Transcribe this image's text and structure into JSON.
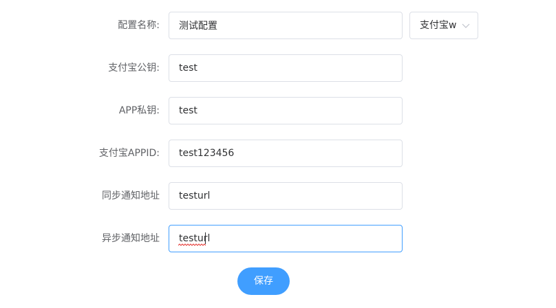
{
  "form": {
    "config_name": {
      "label": "配置名称:",
      "value": "测试配置",
      "select_value": "支付宝w"
    },
    "alipay_public_key": {
      "label": "支付宝公钥:",
      "value": "test"
    },
    "app_private_key": {
      "label": "APP私钥:",
      "value": "test"
    },
    "alipay_appid": {
      "label": "支付宝APPID:",
      "value": "test123456"
    },
    "sync_notify_url": {
      "label": "同步通知地址",
      "value": "testurl"
    },
    "async_notify_url": {
      "label": "异步通知地址",
      "value": "testurl"
    }
  },
  "actions": {
    "save_label": "保存"
  },
  "icons": {
    "select_arrow": "chevron-down-icon"
  },
  "colors": {
    "primary": "#409eff",
    "border": "#dcdfe6",
    "label_text": "#606266",
    "input_text": "#303133"
  }
}
